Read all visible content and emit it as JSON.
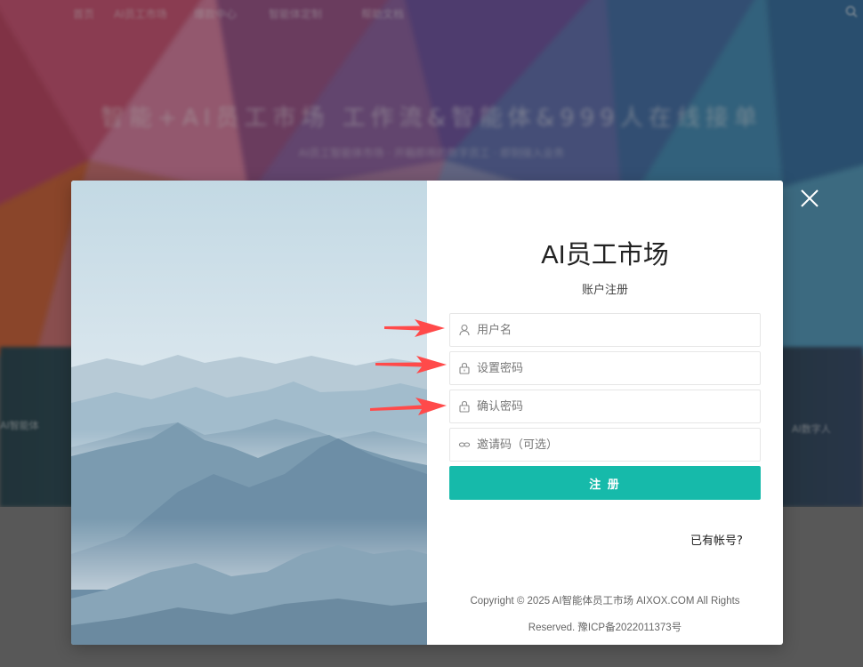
{
  "background": {
    "nav_items": [
      "首页",
      "AI员工市场",
      "爆款中心",
      "智能体定制",
      "帮助文档"
    ],
    "hero_title": "智能+AI员工市场 工作流&智能体&999人在线接单",
    "hero_subtitle": "AI员工智能体市场 · 开箱即用的数字员工 · 即刻接入业务",
    "side_left": "AI智能体",
    "side_right": "AI数字人"
  },
  "modal": {
    "title": "AI员工市场",
    "subtitle": "账户注册",
    "fields": [
      {
        "placeholder": "用户名",
        "icon": "user-icon"
      },
      {
        "placeholder": "设置密码",
        "icon": "lock-icon"
      },
      {
        "placeholder": "确认密码",
        "icon": "lock-icon"
      },
      {
        "placeholder": "邀请码（可选）",
        "icon": "link-icon"
      }
    ],
    "submit_label": "注 册",
    "login_link": "已有帐号?",
    "copyright_line1": "Copyright © 2025 AI智能体员工市场  AIXOX.COM  All Rights",
    "copyright_line2": "Reserved.  豫ICP备2022011373号",
    "close_icon": "close-icon"
  },
  "colors": {
    "accent": "#16baaa",
    "arrow": "#ff4a4a"
  }
}
